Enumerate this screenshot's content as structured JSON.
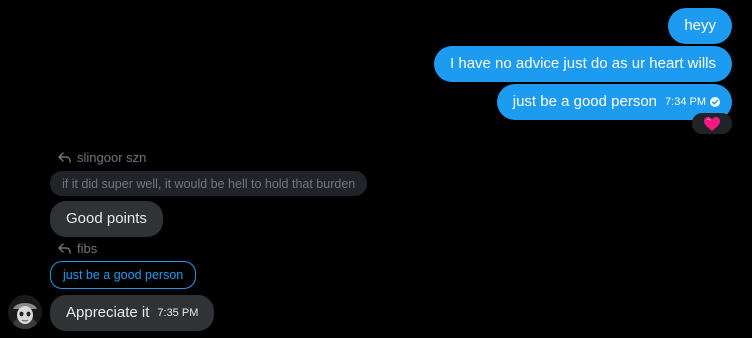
{
  "messages_out": [
    {
      "text": "heyy"
    },
    {
      "text": "I have no advice just do as ur heart wills"
    },
    {
      "text": "just be a good person",
      "time": "7:34 PM"
    }
  ],
  "reaction": {
    "emoji": "heart-emoji",
    "color": "#f91880"
  },
  "reply_1": {
    "replied_to": "slingoor szn",
    "quote": "if it did super well, it would be hell to hold that burden",
    "text": "Good points"
  },
  "reply_2": {
    "replied_to": "fibs",
    "quote": "just be a good person",
    "text": "Appreciate it",
    "time": "7:35 PM"
  },
  "colors": {
    "accent": "#1d9bf0",
    "incoming_bubble": "#2f3336",
    "background": "#000000"
  }
}
